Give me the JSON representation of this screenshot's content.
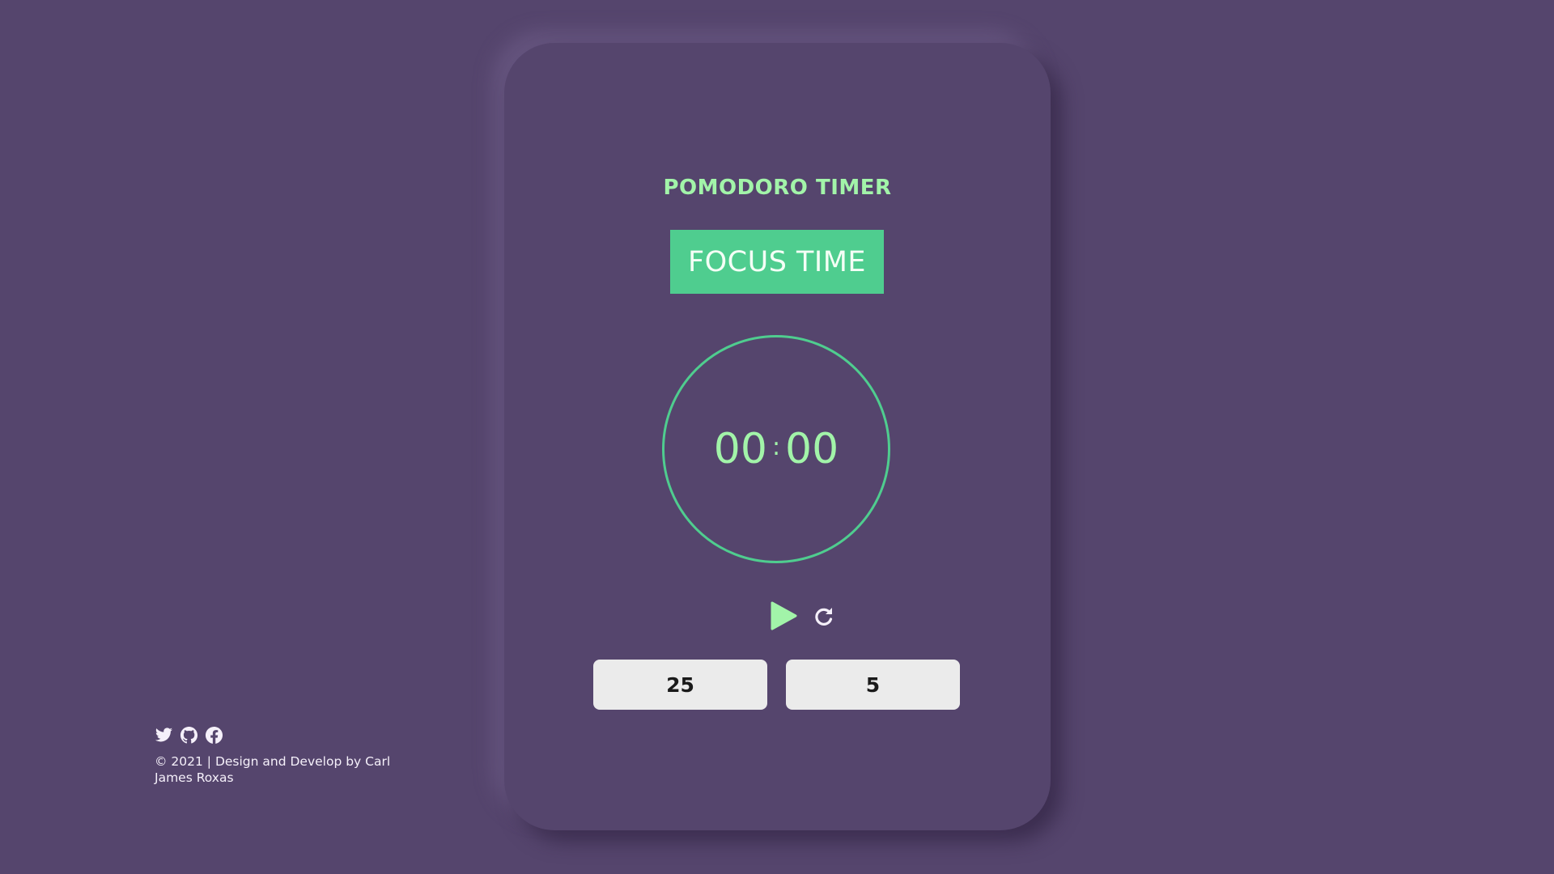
{
  "app": {
    "title": "POMODORO TIMER",
    "mode_label": "FOCUS TIME"
  },
  "timer": {
    "minutes": "00",
    "separator": ":",
    "seconds": "00"
  },
  "controls": {
    "play_icon": "play-icon",
    "reset_icon": "reset-icon"
  },
  "lengths": {
    "focus_minutes": "25",
    "break_minutes": "5"
  },
  "footer": {
    "social_icons": [
      "twitter-icon",
      "github-icon",
      "facebook-icon"
    ],
    "credit": "© 2021 | Design and Develop by Carl James Roxas"
  },
  "colors": {
    "background": "#55456d",
    "accent": "#4fcd8f",
    "text_accent": "#a2f4a9",
    "button_bg": "#ebebeb"
  }
}
